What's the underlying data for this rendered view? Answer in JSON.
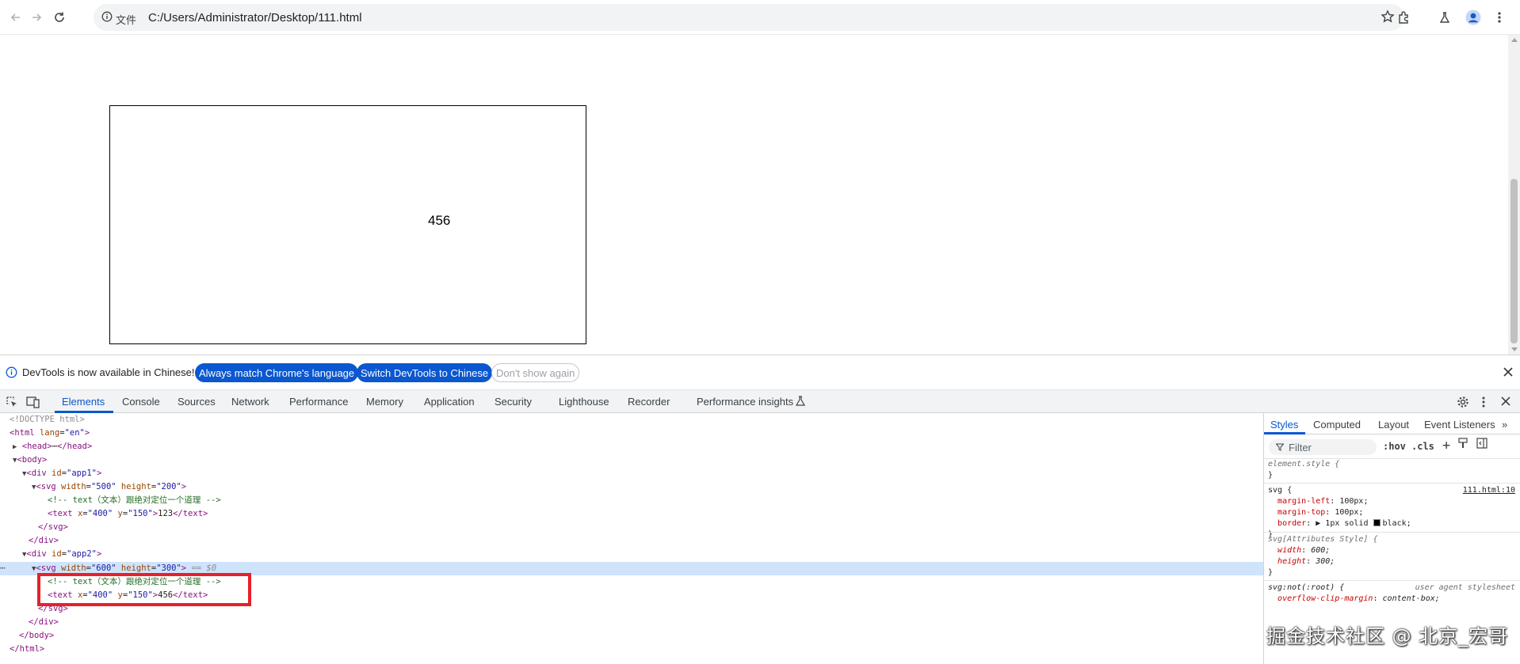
{
  "browser": {
    "scheme_label": "文件",
    "url": "C:/Users/Administrator/Desktop/111.html"
  },
  "page": {
    "svg_text": "456"
  },
  "infobar": {
    "message": "DevTools is now available in Chinese!",
    "btn_match": "Always match Chrome's language",
    "btn_switch": "Switch DevTools to Chinese",
    "btn_dismiss": "Don't show again"
  },
  "devtools_tabs": [
    "Elements",
    "Console",
    "Sources",
    "Network",
    "Performance",
    "Memory",
    "Application",
    "Security",
    "Lighthouse",
    "Recorder",
    "Performance insights"
  ],
  "dom": {
    "doctype": "<!DOCTYPE html>",
    "html_open_tag": "<html",
    "lang_attr": "lang",
    "lang_val": "\"en\"",
    "close_bracket": ">",
    "head_open": "<head>",
    "ellipsis": "⋯",
    "head_close": "</head>",
    "body_open": "<body>",
    "div_open": "<div",
    "id_attr": "id",
    "app1": "\"app1\"",
    "app2": "\"app2\"",
    "svg_open": "<svg",
    "width_attr": "width",
    "height_attr": "height",
    "w500": "\"500\"",
    "h200": "\"200\"",
    "w600": "\"600\"",
    "h300": "\"300\"",
    "comment": "<!-- text（文本）跟绝对定位一个道理 -->",
    "text_open": "<text",
    "x_attr": "x",
    "y_attr": "y",
    "x400": "\"400\"",
    "y150": "\"150\"",
    "text123": "123",
    "text456": "456",
    "text_close": "</text>",
    "svg_close": "</svg>",
    "div_close": "</div>",
    "body_close": "</body>",
    "html_close": "</html>",
    "selected_marker": "== $0",
    "dots": "⋯"
  },
  "styles_tabs": [
    "Styles",
    "Computed",
    "Layout",
    "Event Listeners"
  ],
  "styles": {
    "filter_placeholder": "Filter",
    "hov": ":hov",
    "cls": ".cls",
    "element_style": "element.style {",
    "close_brace": "}",
    "svg_rule_selector": "svg {",
    "svg_rule_source": "111.html:10",
    "margin_left_prop": "margin-left",
    "margin_left_val": "100px;",
    "margin_top_prop": "margin-top",
    "margin_top_val": "100px;",
    "border_prop": "border",
    "border_val": "1px solid",
    "border_color": "black;",
    "attr_style_selector": "svg[Attributes Style] {",
    "width_prop": "width",
    "width_val": "600;",
    "height_prop": "height",
    "height_val": "300;",
    "ua_selector": "svg:not(:root) {",
    "ua_label": "user agent stylesheet",
    "overflow_prop": "overflow-clip-margin",
    "overflow_val": "content-box;",
    "colon": ":"
  },
  "watermark": "掘金技术社区 @ 北京_宏哥",
  "colors": {
    "accent": "#0b57d0",
    "highlight_border": "#e8202a",
    "selected_row": "#cfe3fb"
  }
}
